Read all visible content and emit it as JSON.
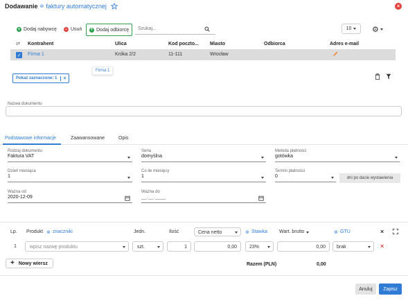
{
  "header": {
    "title": "Dodawanie",
    "subtitle": "faktury automatycznej"
  },
  "toolbar": {
    "add_buyer": "Dodaj nabywcę",
    "delete": "Usuń",
    "add_recipient": "Dodaj odbiorcę",
    "search_placeholder": "Szukaj...",
    "page_size": "10"
  },
  "contractors_table": {
    "columns": [
      "Kontrahent",
      "Ulica",
      "Kod poczto...",
      "Miasto",
      "Odbiorca",
      "Adres e-mail"
    ],
    "rows": [
      {
        "kontrahent": "Firma 1",
        "ulica": "Króka 2/2",
        "kod": "11-111",
        "miasto": "Wrocław",
        "odbiorca": "",
        "email": ""
      }
    ],
    "tooltip": "Firma 1",
    "show_selected": "Pokaż zaznaczone: 1"
  },
  "document": {
    "name_label": "Nazwa dokumentu",
    "name_value": ""
  },
  "tabs": [
    "Podstawowe informacje",
    "Zaawansowane",
    "Opis"
  ],
  "form": {
    "rodzaj_label": "Rodzaj dokumentu",
    "rodzaj_value": "Faktura VAT",
    "seria_label": "Seria",
    "seria_value": "domyślna",
    "metoda_label": "Metoda płatności",
    "metoda_value": "gotówka",
    "dzien_label": "Dzień miesiąca",
    "dzien_value": "1",
    "co_ile_label": "Co ile miesięcy",
    "co_ile_value": "1",
    "termin_label": "Termin płatności",
    "termin_value": "0",
    "termin_suffix": "dni po dacie wystawienia",
    "wazne_od_label": "Ważna od",
    "wazne_od_value": "2020-12-09",
    "wazne_do_label": "Ważna do",
    "wazne_do_value": "__.__.____"
  },
  "products": {
    "headers": {
      "lp": "Lp.",
      "produkt": "Produkt",
      "znaczniki": "znaczniki",
      "jedn": "Jedn.",
      "ilosc": "Ilość",
      "cena": "Cena netto",
      "stawka": "Stawka",
      "wart": "Wart. brutto",
      "gtu": "GTU"
    },
    "row": {
      "lp": "1",
      "product_placeholder": "wpisz nazwę produktu",
      "jedn": "szt.",
      "ilosc": "1",
      "cena": "0,00",
      "stawka": "23%",
      "wart": "0,00",
      "gtu": "brak"
    },
    "new_row": "Nowy wiersz",
    "sum_label": "Razem (PLN)",
    "sum_value": "0,00"
  },
  "footer": {
    "cancel": "Anuluj",
    "save": "Zapisz"
  },
  "colors": {
    "accent": "#2f7bd6",
    "green": "#2e9e4f",
    "red": "#e0433e",
    "orange": "#f0882e"
  }
}
